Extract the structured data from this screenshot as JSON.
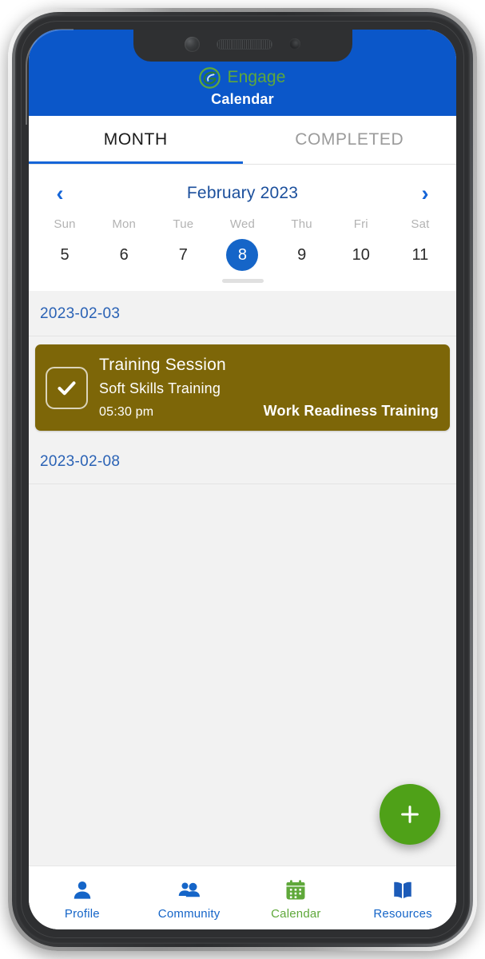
{
  "app": {
    "brand_name": "Engage",
    "brand_logo_icon": "engage-swirl-logo",
    "page_title": "Calendar",
    "header_color": "#0B57C9",
    "brand_color": "#5FA83A"
  },
  "tabs": [
    {
      "label": "MONTH",
      "active": true
    },
    {
      "label": "COMPLETED",
      "active": false
    }
  ],
  "calendar": {
    "prev_icon": "chevron-left-icon",
    "next_icon": "chevron-right-icon",
    "month_label": "February 2023",
    "day_names": [
      "Sun",
      "Mon",
      "Tue",
      "Wed",
      "Thu",
      "Fri",
      "Sat"
    ],
    "days": [
      {
        "num": "5",
        "selected": false
      },
      {
        "num": "6",
        "selected": false
      },
      {
        "num": "7",
        "selected": false
      },
      {
        "num": "8",
        "selected": true
      },
      {
        "num": "9",
        "selected": false
      },
      {
        "num": "10",
        "selected": false
      },
      {
        "num": "11",
        "selected": false
      }
    ],
    "selected_day_color": "#1565C8",
    "drag_handle": "calendar-drag-handle"
  },
  "agenda": {
    "sections": [
      {
        "date": "2023-02-03",
        "events": [
          {
            "title": "Training Session",
            "subtitle": "Soft Skills Training",
            "time": "05:30 pm",
            "tag": "Work Readiness Training",
            "color": "#7D6608",
            "check_icon": "checkmark-icon",
            "completed": true
          }
        ]
      },
      {
        "date": "2023-02-08",
        "events": []
      }
    ]
  },
  "fab": {
    "icon": "plus-icon",
    "label": "+",
    "color": "#4FA118"
  },
  "bottom_nav": {
    "items": [
      {
        "label": "Profile",
        "icon": "person-icon",
        "active": false
      },
      {
        "label": "Community",
        "icon": "people-group-icon",
        "active": false
      },
      {
        "label": "Calendar",
        "icon": "calendar-icon",
        "active": true
      },
      {
        "label": "Resources",
        "icon": "open-book-icon",
        "active": false
      }
    ],
    "inactive_color": "#1565C8",
    "active_color": "#5FA83A"
  }
}
